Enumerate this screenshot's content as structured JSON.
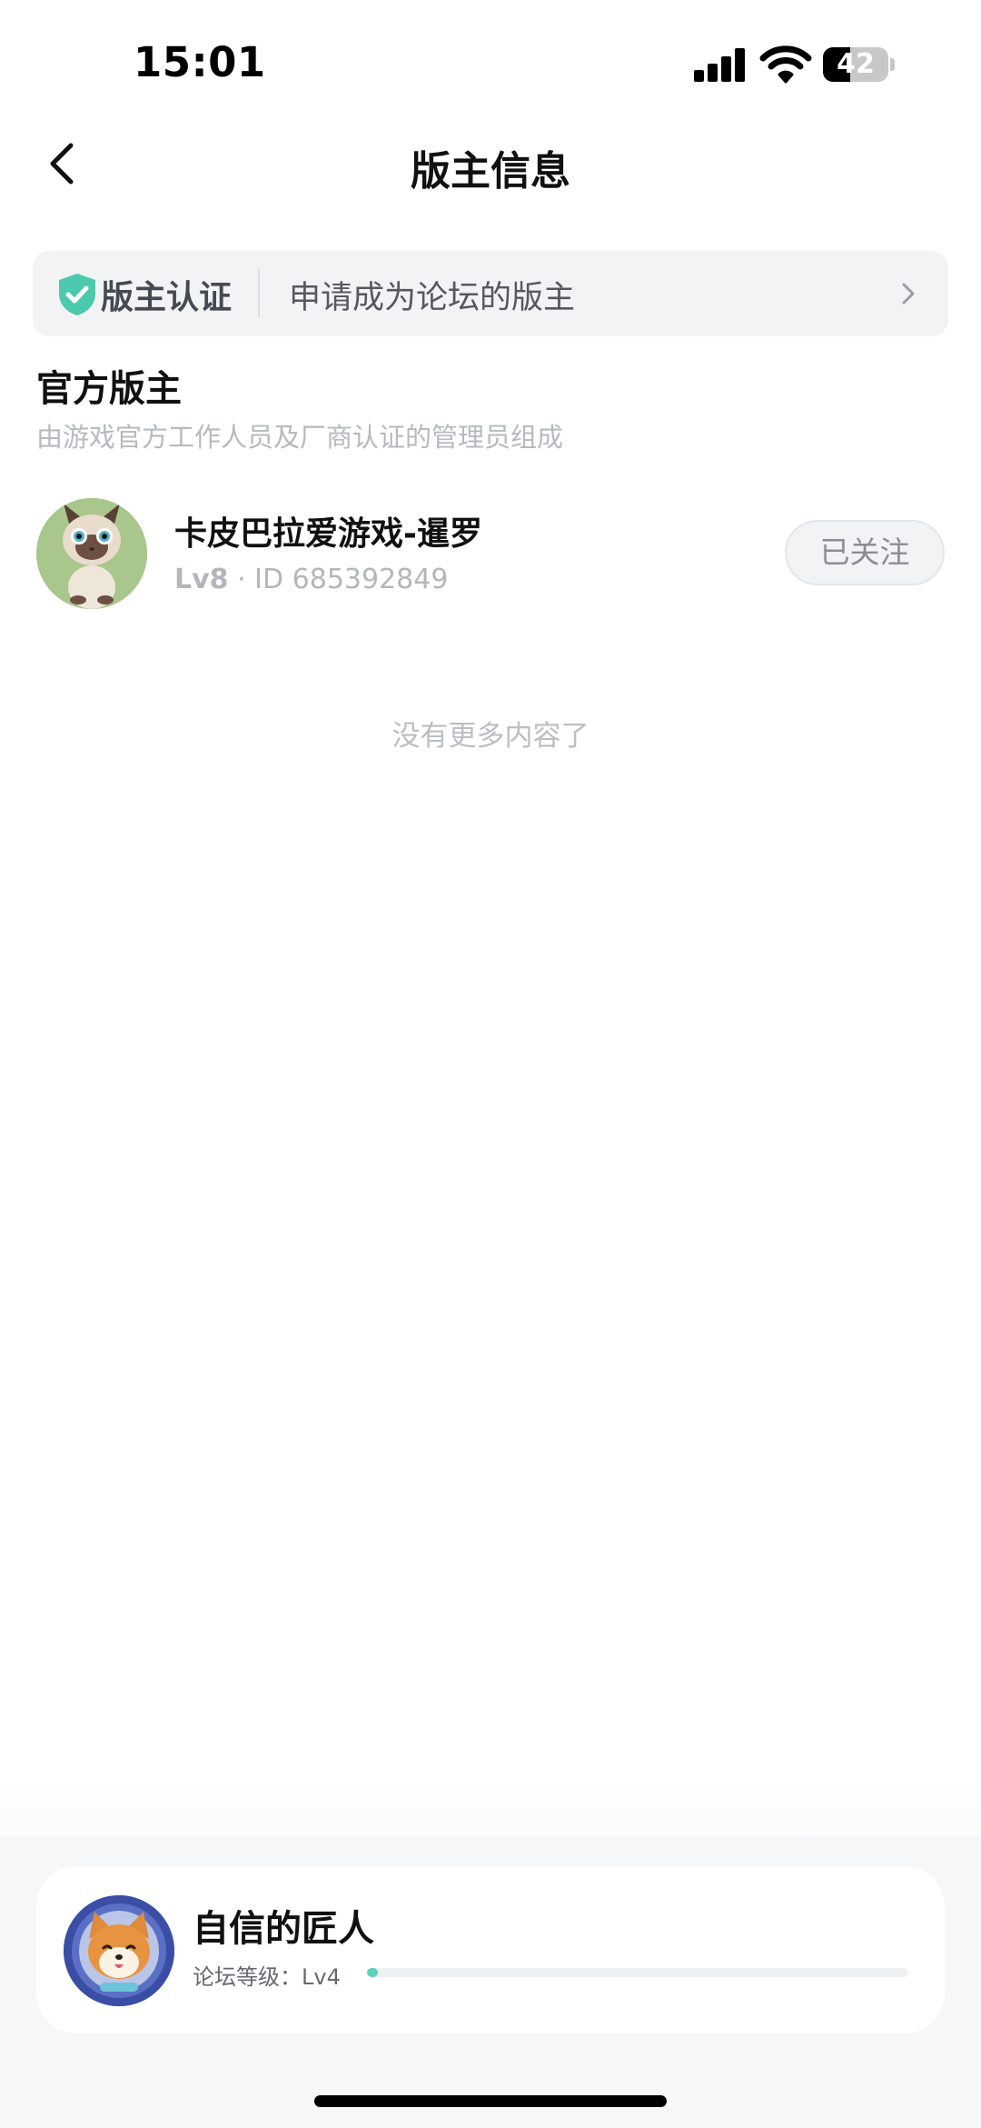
{
  "status_bar": {
    "time": "15:01",
    "battery_level": "42",
    "battery_fraction": 0.42
  },
  "nav": {
    "title": "版主信息"
  },
  "cert_banner": {
    "label": "版主认证",
    "apply_text": "申请成为论坛的版主",
    "accent_color": "#4cc9ad"
  },
  "section": {
    "title": "官方版主",
    "subtitle": "由游戏官方工作人员及厂商认证的管理员组成"
  },
  "moderators": [
    {
      "name": "卡皮巴拉爱游戏-暹罗",
      "level": "Lv8",
      "separator": " · ",
      "id_text": "ID 685392849",
      "follow_label": "已关注"
    }
  ],
  "list_end_text": "没有更多内容了",
  "user_card": {
    "name": "自信的匠人",
    "level_label": "论坛等级：Lv4",
    "level_progress": 0.02,
    "progress_color": "#5fd0b8"
  }
}
